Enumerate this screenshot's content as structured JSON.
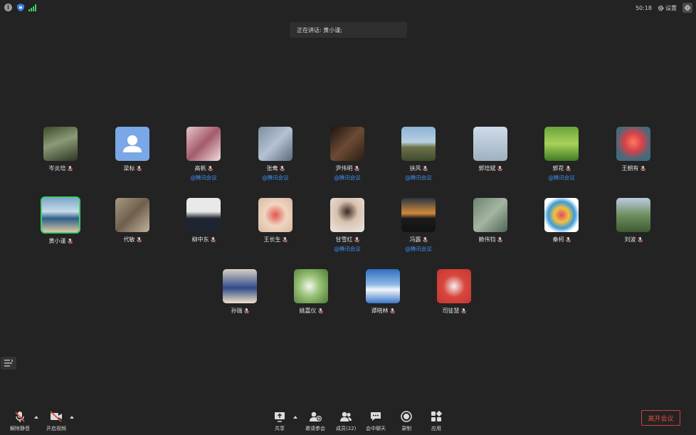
{
  "header": {
    "speaking": "正在讲话: 黄小谨;",
    "time": "50:18",
    "settings_label": "设置"
  },
  "participants": [
    {
      "name": "岑炎培",
      "tag": "",
      "bg": "linear-gradient(160deg,#3a4a2a,#8c9a78 45%,#2d3820)"
    },
    {
      "name": "梁标",
      "tag": "",
      "bg": "#7aa7e6"
    },
    {
      "name": "高帆",
      "tag": "@腾讯会议",
      "bg": "linear-gradient(135deg,#e8c6c9,#a35b6b 50%,#f2dce0)"
    },
    {
      "name": "张鸯",
      "tag": "@腾讯会议",
      "bg": "linear-gradient(135deg,#7e8ea0,#b4c2d2 50%,#5a6a7c)"
    },
    {
      "name": "尹伟明",
      "tag": "@腾讯会议",
      "bg": "linear-gradient(135deg,#1c1410,#6d4b34 50%,#2a1d14)"
    },
    {
      "name": "扶风",
      "tag": "@腾讯会议",
      "bg": "linear-gradient(180deg,#8bb3d6 0%,#b9d0e2 45%,#6b7348 60%,#3f4a2c 100%)"
    },
    {
      "name": "郭培斌",
      "tag": "",
      "bg": "linear-gradient(180deg,#cfdce8,#9fb1c2)"
    },
    {
      "name": "郭花",
      "tag": "@腾讯会议",
      "bg": "linear-gradient(180deg,#6aa43a,#a8d25a 50%,#3f7a22)"
    },
    {
      "name": "王朝有",
      "tag": "",
      "bg": "radial-gradient(circle at 50% 45%,#ff7a60,#d6424a 35%,#446a7c 70%)"
    },
    {
      "name": "黄小谨",
      "tag": "",
      "bg": "linear-gradient(180deg,#7fa6cc 0%,#c8dbe8 40%,#2f5e88 60%,#d9c8a5 100%)",
      "active": true
    },
    {
      "name": "代敏",
      "tag": "",
      "bg": "linear-gradient(135deg,#a89a82,#6f5f4e 50%,#c2b49c)"
    },
    {
      "name": "柳中东",
      "tag": "",
      "bg": "linear-gradient(180deg,#e9e9e9 0%,#e9e9e9 40%,#1e2530 60%,#1e2530 100%)"
    },
    {
      "name": "王长生",
      "tag": "",
      "bg": "radial-gradient(circle at 50% 50%,#e2574c,#efd6c2 45%,#d9b8a0)"
    },
    {
      "name": "甘雪红",
      "tag": "@腾讯会议",
      "bg": "radial-gradient(circle at 50% 40%,#3a2a22,#d9c2b0 40%,#ece6e2)"
    },
    {
      "name": "冯露",
      "tag": "@腾讯会议",
      "bg": "linear-gradient(180deg,#2b3442 0%,#d08a3c 45%,#1a1a1a 60%,#121212 100%)"
    },
    {
      "name": "赖伟钧",
      "tag": "",
      "bg": "linear-gradient(135deg,#6d8270,#a5b6a2 50%,#4f6555)"
    },
    {
      "name": "秦柯",
      "tag": "",
      "bg": "radial-gradient(circle at 50% 50%,#e04a6a,#f1c23b 30%,#3a9ad9 55%,#ffffff 75%)"
    },
    {
      "name": "刘波",
      "tag": "",
      "bg": "linear-gradient(180deg,#b9cce0 0%,#6f8f5e 50%,#3e5a33 100%)"
    },
    {
      "name": "孙瑞",
      "tag": "",
      "bg": "linear-gradient(180deg,#d8d0c6 0%,#2f4a8a 55%,#f0e2c6 100%)"
    },
    {
      "name": "姚嘉仪",
      "tag": "",
      "bg": "radial-gradient(circle at 45% 50%,#f5f5f0,#9cc47a 40%,#4e7a34)"
    },
    {
      "name": "谭晓林",
      "tag": "",
      "bg": "linear-gradient(180deg,#2f6fc2 0%,#8eb8e6 45%,#f2f6fa 60%,#3b78c8 100%)"
    },
    {
      "name": "司徒慧",
      "tag": "",
      "bg": "radial-gradient(circle at 50% 50%,#f2f2f2,#d9473f 45%,#c2362f)"
    }
  ],
  "toolbar": {
    "mute": "解除静音",
    "video": "开启视频",
    "share": "共享",
    "invite": "邀请参会",
    "members": "成员(22)",
    "chat": "会中聊天",
    "record": "录制",
    "apps": "应用",
    "leave": "离开会议"
  },
  "colors": {
    "active_border": "#3fcf6b",
    "tag": "#3d8ff0",
    "leave": "#e04a3f"
  }
}
